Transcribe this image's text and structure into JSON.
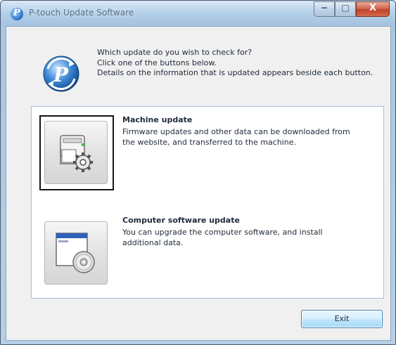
{
  "window": {
    "title": "P-touch Update Software",
    "minimize_glyph": "−",
    "maximize_glyph": "□",
    "close_glyph": "X"
  },
  "intro": {
    "line1": "Which update do you wish to check for?",
    "line2": "Click one of the buttons below.",
    "line3": "Details on the information that is updated appears beside each button."
  },
  "options": [
    {
      "title": "Machine update",
      "description": "Firmware updates and other data can be downloaded from the website, and transferred to the machine.",
      "icon": "printer-gear-icon"
    },
    {
      "title": "Computer software update",
      "description": "You can upgrade the computer software, and install additional data.",
      "icon": "window-disc-icon"
    }
  ],
  "footer": {
    "exit_label": "Exit"
  },
  "colors": {
    "panel_border": "#a9bfd6",
    "focus_frame": "#151515",
    "exit_button": "#bee6fd"
  }
}
